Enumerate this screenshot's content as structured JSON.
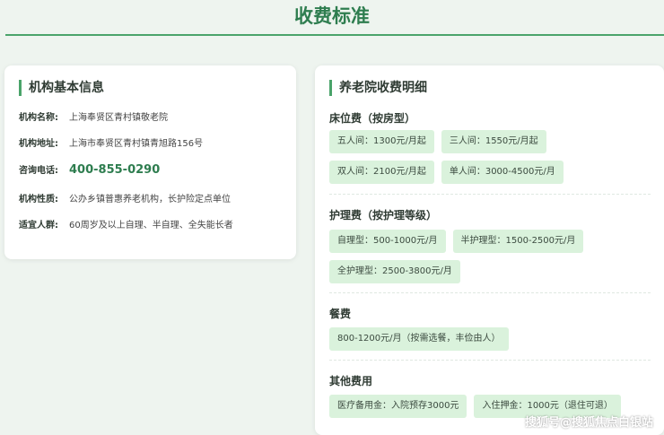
{
  "page": {
    "title": "收费标准"
  },
  "basic_info": {
    "heading": "机构基本信息",
    "rows": [
      {
        "label": "机构名称:",
        "value": "上海奉贤区青村镇敬老院"
      },
      {
        "label": "机构地址:",
        "value": "上海市奉贤区青村镇青旭路156号"
      },
      {
        "label": "咨询电话:",
        "value": "400-855-0290"
      },
      {
        "label": "机构性质:",
        "value": "公办乡镇普惠养老机构，长护险定点单位"
      },
      {
        "label": "适宜人群:",
        "value": "60周岁及以上自理、半自理、全失能长者"
      }
    ]
  },
  "fees": {
    "heading": "养老院收费明细",
    "sections": [
      {
        "title": "床位费（按房型）",
        "tags": [
          "五人间：1300元/月起",
          "三人间：1550元/月起",
          "双人间：2100元/月起",
          "单人间：3000-4500元/月"
        ]
      },
      {
        "title": "护理费（按护理等级）",
        "tags": [
          "自理型：500-1000元/月",
          "半护理型：1500-2500元/月",
          "全护理型：2500-3800元/月"
        ]
      },
      {
        "title": "餐费",
        "tags": [
          "800-1200元/月（按需选餐，丰俭由人）"
        ]
      },
      {
        "title": "其他费用",
        "tags": [
          "医疗备用金：入院预存3000元",
          "入住押金：1000元（退住可退）"
        ]
      }
    ]
  },
  "watermark": "搜狐号@搜狐焦点白银站",
  "colors": {
    "accent": "#2e7d4f",
    "tag_bg": "#daf2dc",
    "page_bg": "#eef4ef"
  }
}
